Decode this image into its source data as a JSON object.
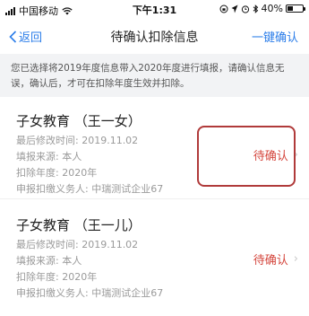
{
  "status_bar": {
    "carrier": "中国移动",
    "time": "下午1:31",
    "battery": "40%",
    "battery_level": 0.4
  },
  "nav": {
    "back_label": "返回",
    "title": "待确认扣除信息",
    "action_label": "一键确认"
  },
  "notice": "您已选择将2019年度信息带入2020年度进行填报，请确认信息无误，确认后，才可在扣除年度生效并扣除。",
  "items": [
    {
      "title": "子女教育 （王一女）",
      "modified": "最后修改时间: 2019.11.02",
      "source": "填报来源: 本人",
      "year": "扣除年度: 2020年",
      "withholder": "申报扣缴义务人: 中瑞测试企业67",
      "status": "待确认"
    },
    {
      "title": "子女教育 （王一儿）",
      "modified": "最后修改时间: 2019.11.02",
      "source": "填报来源: 本人",
      "year": "扣除年度: 2020年",
      "withholder": "申报扣缴义务人: 中瑞测试企业67",
      "status": "待确认"
    }
  ],
  "colors": {
    "accent": "#2b7de9",
    "status": "#d4453c",
    "highlight": "#b03a3a",
    "notice_bg": "#f2f3f5"
  }
}
